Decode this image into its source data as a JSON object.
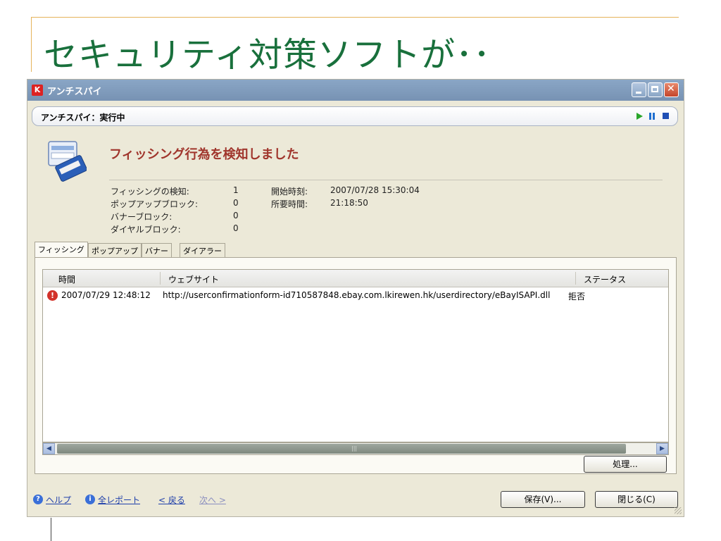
{
  "slide": {
    "title": "セキュリティ対策ソフトが･･"
  },
  "window": {
    "title": "アンチスパイ",
    "status": "アンチスパイ：実行中",
    "headline": "フィッシング行為を検知しました",
    "stats_left": [
      {
        "label": "フィッシングの検知:",
        "value": "1"
      },
      {
        "label": "ポップアップブロック:",
        "value": "0"
      },
      {
        "label": "バナーブロック:",
        "value": "0"
      },
      {
        "label": "ダイヤルブロック:",
        "value": "0"
      }
    ],
    "stats_right": [
      {
        "label": "開始時刻:",
        "value": "2007/07/28 15:30:04"
      },
      {
        "label": "所要時間:",
        "value": "21:18:50"
      }
    ],
    "tabs": [
      {
        "label": "フィッシング",
        "active": true
      },
      {
        "label": "ポップアップ",
        "active": false
      },
      {
        "label": "バナー",
        "active": false
      },
      {
        "label": "ダイアラー",
        "active": false
      }
    ],
    "table": {
      "columns": [
        "時間",
        "ウェブサイト",
        "ステータス"
      ],
      "rows": [
        {
          "time": "2007/07/29 12:48:12",
          "site": "http://userconfirmationform-id710587848.ebay.com.lkirewen.hk/userdirectory/eBayISAPI.dll",
          "status": "拒否"
        }
      ]
    },
    "buttons": {
      "process": "処理...",
      "save": "保存(V)...",
      "close": "閉じる(C)"
    },
    "footer": {
      "help": "ヘルプ",
      "full_report": "全レポート",
      "back": "< 戻る",
      "next": "次へ >"
    }
  }
}
